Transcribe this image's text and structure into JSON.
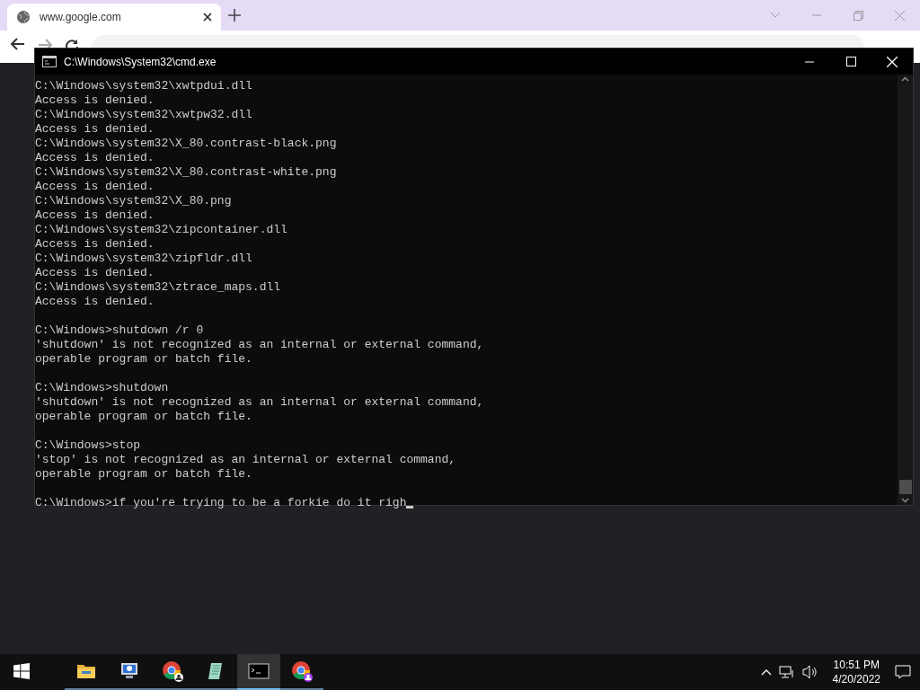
{
  "browser": {
    "tab": {
      "title": "www.google.com",
      "selected": true
    }
  },
  "console_window": {
    "title": "C:\\Windows\\System32\\cmd.exe",
    "blocks": [
      [
        "C:\\Windows\\system32\\xwtpdui.dll",
        "Access is denied.",
        "C:\\Windows\\system32\\xwtpw32.dll",
        "Access is denied.",
        "C:\\Windows\\system32\\X_80.contrast-black.png",
        "Access is denied.",
        "C:\\Windows\\system32\\X_80.contrast-white.png",
        "Access is denied.",
        "C:\\Windows\\system32\\X_80.png",
        "Access is denied.",
        "C:\\Windows\\system32\\zipcontainer.dll",
        "Access is denied.",
        "C:\\Windows\\system32\\zipfldr.dll",
        "Access is denied.",
        "C:\\Windows\\system32\\ztrace_maps.dll",
        "Access is denied."
      ],
      [
        "C:\\Windows>shutdown /r 0",
        "'shutdown' is not recognized as an internal or external command,",
        "operable program or batch file."
      ],
      [
        "C:\\Windows>shutdown",
        "'shutdown' is not recognized as an internal or external command,",
        "operable program or batch file."
      ],
      [
        "C:\\Windows>stop",
        "'stop' is not recognized as an internal or external command,",
        "operable program or batch file."
      ],
      [
        "C:\\Windows>if you're trying to be a forkie do it righ"
      ]
    ]
  },
  "taskbar": {
    "apps": [
      {
        "kind": "folder",
        "selected": false
      },
      {
        "kind": "computer",
        "selected": false
      },
      {
        "kind": "chrome",
        "selected": false
      },
      {
        "kind": "notepad",
        "selected": false
      },
      {
        "kind": "console",
        "selected": true
      },
      {
        "kind": "chrome-profile",
        "selected": false
      }
    ],
    "time": "10:51 PM",
    "date": "4/20/2022"
  }
}
